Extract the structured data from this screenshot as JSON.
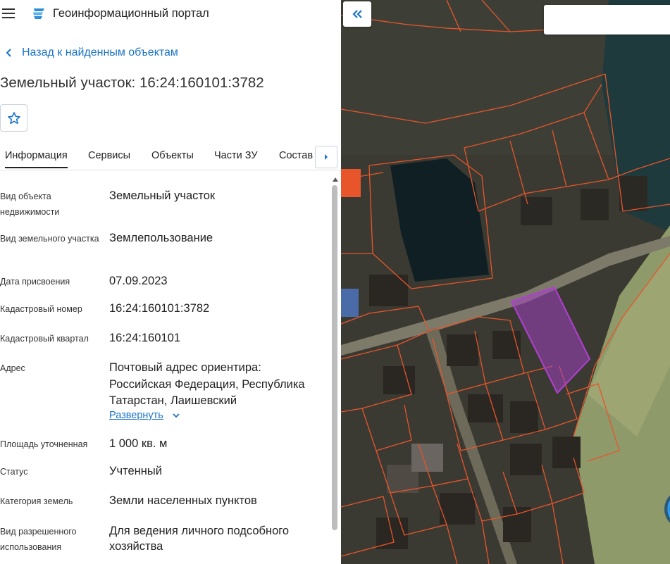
{
  "header": {
    "menu_icon": "hamburger-icon",
    "logo_icon": "portal-logo-icon",
    "title": "Геоинформационный портал"
  },
  "nav": {
    "back_label": "Назад к найденным объектам"
  },
  "object": {
    "title": "Земельный участок: 16:24:160101:3782"
  },
  "tabs": [
    {
      "label": "Информация",
      "active": true
    },
    {
      "label": "Сервисы"
    },
    {
      "label": "Объекты"
    },
    {
      "label": "Части ЗУ"
    },
    {
      "label": "Состав"
    }
  ],
  "details": [
    {
      "label": "Вид объекта недвижимости",
      "value": "Земельный участок"
    },
    {
      "label": "Вид земельного участка",
      "value": "Землепользование"
    },
    {
      "label": "Дата присвоения",
      "value": "07.09.2023"
    },
    {
      "label": "Кадастровый номер",
      "value": "16:24:160101:3782"
    },
    {
      "label": "Кадастровый квартал",
      "value": "16:24:160101"
    },
    {
      "label": "Адрес",
      "value": "Почтовый адрес ориентира: Российская Федерация, Республика Татарстан, Лаишевский"
    },
    {
      "label": "Площадь уточненная",
      "value": "1 000 кв. м"
    },
    {
      "label": "Статус",
      "value": "Учтенный"
    },
    {
      "label": "Категория земель",
      "value": "Земли населенных пунктов"
    },
    {
      "label": "Вид разрешенного использования",
      "value": "Для ведения личного подсобного хозяйства"
    }
  ],
  "expand_label": "Развернуть",
  "colors": {
    "link": "#1a73c9",
    "parcel_border": "#e8552b",
    "selected_parcel": "#a040c0"
  }
}
